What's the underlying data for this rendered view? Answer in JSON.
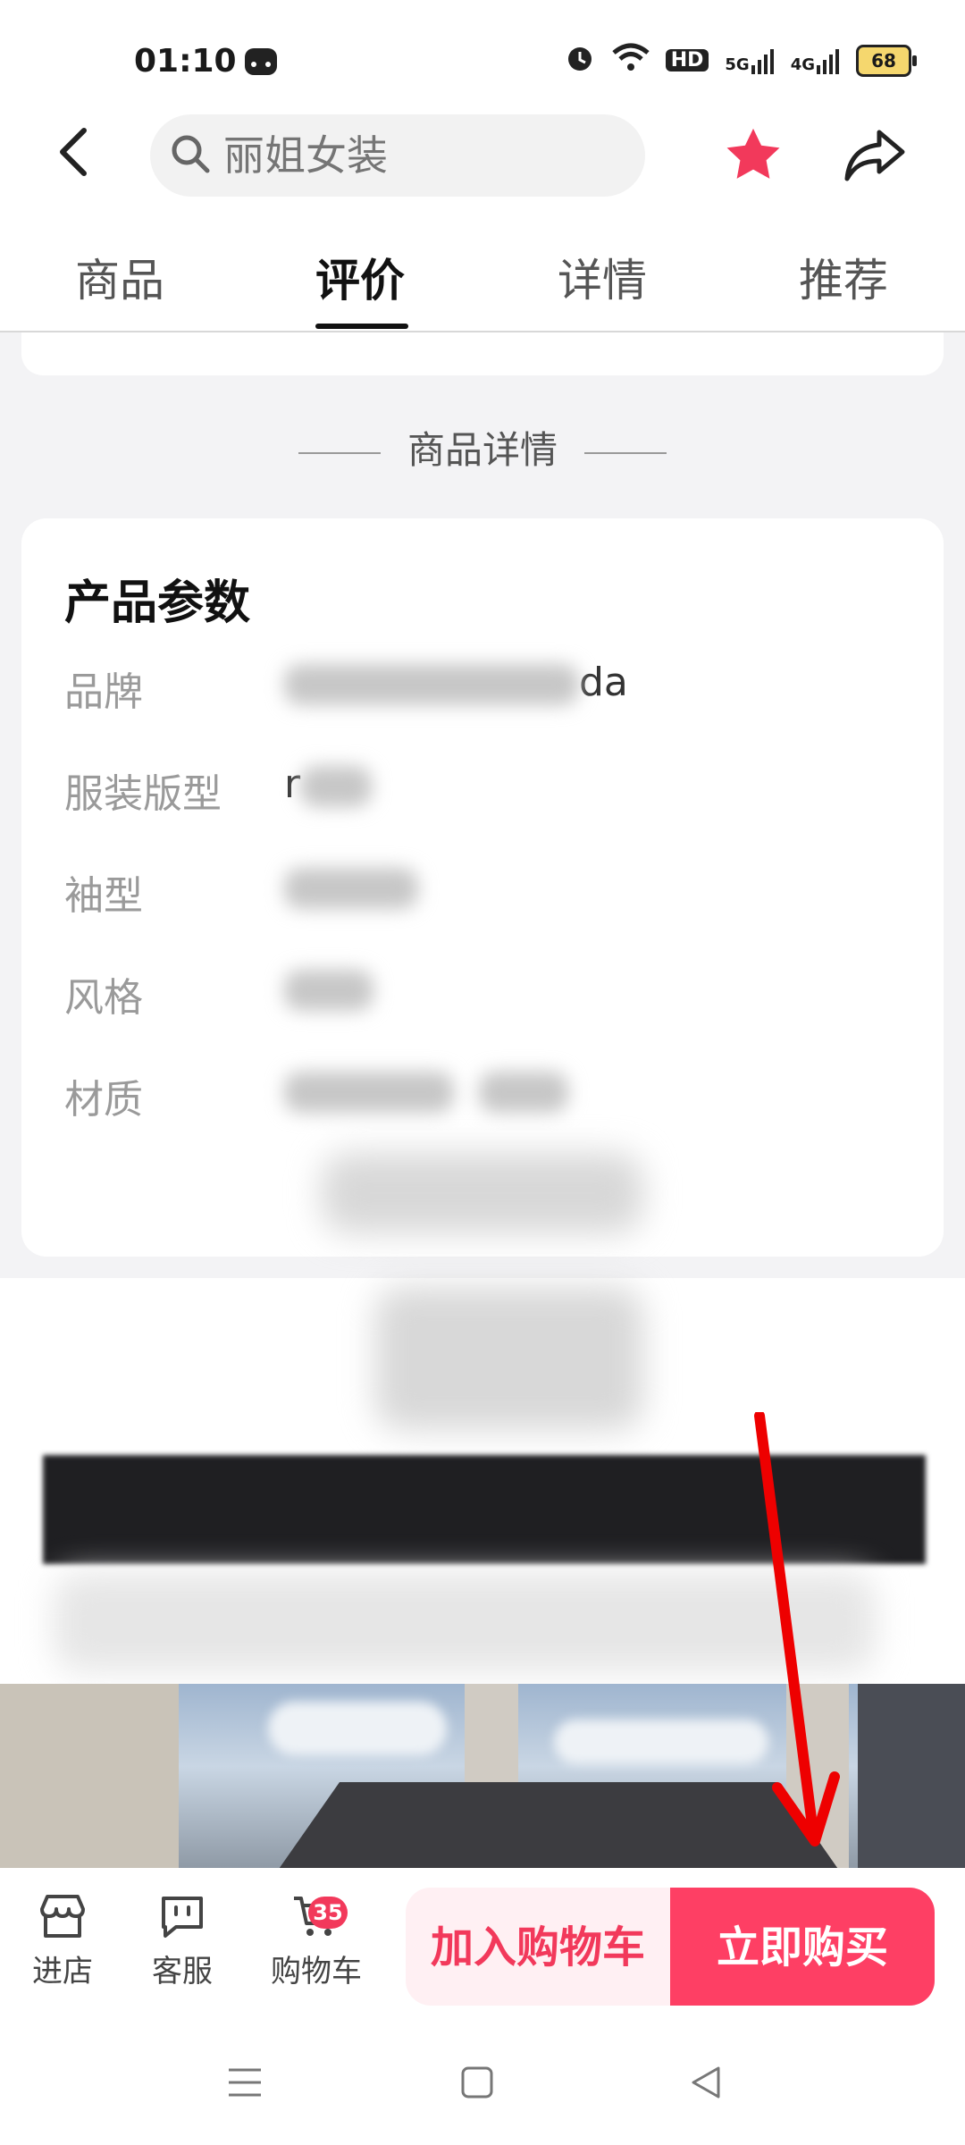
{
  "status_bar": {
    "time": "01:10",
    "icons": [
      "alarm-icon",
      "wifi-icon",
      "hd-icon",
      "signal-5g-icon",
      "signal-4g-icon"
    ],
    "signal_5g": "5G",
    "signal_4g": "4G",
    "hd": "HD",
    "battery": "68"
  },
  "header": {
    "search_placeholder": "丽姐女装",
    "favorite_color": "#f2395b"
  },
  "tabs": [
    {
      "label": "商品",
      "active": false
    },
    {
      "label": "评价",
      "active": true
    },
    {
      "label": "详情",
      "active": false
    },
    {
      "label": "推荐",
      "active": false
    }
  ],
  "details": {
    "section_title": "商品详情",
    "params_title": "产品参数",
    "params": [
      {
        "label": "品牌",
        "value_visible": "da"
      },
      {
        "label": "服装版型",
        "value_visible": "r"
      },
      {
        "label": "袖型",
        "value_visible": ""
      },
      {
        "label": "风格",
        "value_visible": ""
      },
      {
        "label": "材质",
        "value_visible": ""
      }
    ]
  },
  "bottom_bar": {
    "store_label": "进店",
    "service_label": "客服",
    "cart_label": "购物车",
    "cart_badge": "35",
    "add_to_cart": "加入购物车",
    "buy_now": "立即购买"
  },
  "colors": {
    "accent": "#fe3f64",
    "accent_light": "#fff0f3",
    "annotation_arrow": "#ee0000"
  }
}
